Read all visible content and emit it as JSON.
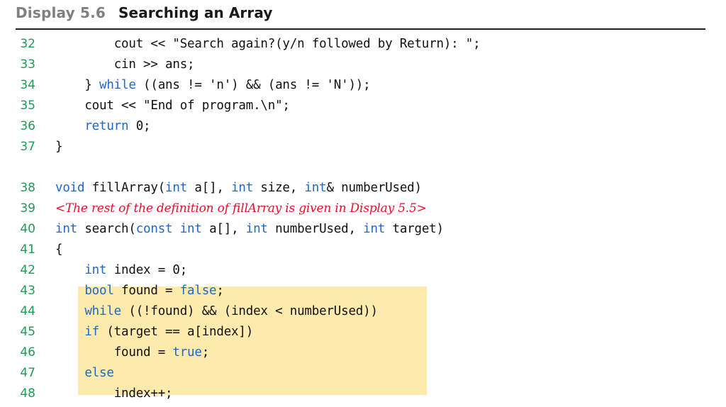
{
  "header": {
    "display_label": "Display 5.6",
    "title": "Searching an Array"
  },
  "highlight": {
    "color": "#fdeaad",
    "first_line": "44",
    "last_line": "48"
  },
  "colors": {
    "line_number": "#1f9a57",
    "keyword": "#2069c4",
    "annotation": "#e8112d",
    "code_text": "#121212",
    "label_gray": "#808080",
    "rule": "#231f20"
  },
  "code": {
    "lines": [
      {
        "no": "32",
        "indent": "        ",
        "segments": [
          {
            "text": "cout << \"Search again?(y/n followed by Return): \";",
            "style": "plain"
          }
        ]
      },
      {
        "no": "33",
        "indent": "        ",
        "segments": [
          {
            "text": "cin >> ans;",
            "style": "plain"
          }
        ]
      },
      {
        "no": "34",
        "indent": "    ",
        "segments": [
          {
            "text": "} ",
            "style": "plain"
          },
          {
            "text": "while",
            "style": "kw"
          },
          {
            "text": " ((ans != 'n') && (ans != 'N'));",
            "style": "plain"
          }
        ]
      },
      {
        "no": "35",
        "indent": "    ",
        "segments": [
          {
            "text": "cout << \"End of program.\\n\";",
            "style": "plain"
          }
        ]
      },
      {
        "no": "36",
        "indent": "    ",
        "segments": [
          {
            "text": "return",
            "style": "kw"
          },
          {
            "text": " 0;",
            "style": "plain"
          }
        ]
      },
      {
        "no": "37",
        "indent": "",
        "segments": [
          {
            "text": "}",
            "style": "plain"
          }
        ]
      },
      {
        "no": "",
        "indent": "",
        "segments": [],
        "spacer": true
      },
      {
        "no": "38",
        "indent": "",
        "segments": [
          {
            "text": "void",
            "style": "kw"
          },
          {
            "text": " fillArray(",
            "style": "plain"
          },
          {
            "text": "int",
            "style": "kw"
          },
          {
            "text": " a[], ",
            "style": "plain"
          },
          {
            "text": "int",
            "style": "kw"
          },
          {
            "text": " size, ",
            "style": "plain"
          },
          {
            "text": "int",
            "style": "kw"
          },
          {
            "text": "& numberUsed)",
            "style": "plain"
          }
        ]
      },
      {
        "no": "39",
        "indent": "",
        "segments": [
          {
            "text": "<The rest of the definition of ",
            "style": "annotation"
          },
          {
            "text": "fillArray",
            "style": "annotation-mono"
          },
          {
            "text": " is given in Display 5.5>",
            "style": "annotation"
          }
        ]
      },
      {
        "no": "40",
        "indent": "",
        "segments": [
          {
            "text": "int",
            "style": "kw"
          },
          {
            "text": " search(",
            "style": "plain"
          },
          {
            "text": "const int",
            "style": "kw"
          },
          {
            "text": " a[], ",
            "style": "plain"
          },
          {
            "text": "int",
            "style": "kw"
          },
          {
            "text": " numberUsed, ",
            "style": "plain"
          },
          {
            "text": "int",
            "style": "kw"
          },
          {
            "text": " target)",
            "style": "plain"
          }
        ]
      },
      {
        "no": "41",
        "indent": "",
        "segments": [
          {
            "text": "{",
            "style": "plain"
          }
        ]
      },
      {
        "no": "42",
        "indent": "    ",
        "segments": [
          {
            "text": "int",
            "style": "kw"
          },
          {
            "text": " index = 0;",
            "style": "plain"
          }
        ]
      },
      {
        "no": "43",
        "indent": "    ",
        "segments": [
          {
            "text": "bool",
            "style": "kw"
          },
          {
            "text": " found = ",
            "style": "plain"
          },
          {
            "text": "false",
            "style": "kw"
          },
          {
            "text": ";",
            "style": "plain"
          }
        ]
      },
      {
        "no": "44",
        "indent": "    ",
        "highlighted": true,
        "segments": [
          {
            "text": "while",
            "style": "kw"
          },
          {
            "text": " ((!found) && (index < numberUsed))",
            "style": "plain"
          }
        ]
      },
      {
        "no": "45",
        "indent": "    ",
        "highlighted": true,
        "segments": [
          {
            "text": "if",
            "style": "kw"
          },
          {
            "text": " (target == a[index])",
            "style": "plain"
          }
        ]
      },
      {
        "no": "46",
        "indent": "        ",
        "highlighted": true,
        "segments": [
          {
            "text": "found = ",
            "style": "plain"
          },
          {
            "text": "true",
            "style": "kw"
          },
          {
            "text": ";",
            "style": "plain"
          }
        ]
      },
      {
        "no": "47",
        "indent": "    ",
        "highlighted": true,
        "segments": [
          {
            "text": "else",
            "style": "kw"
          }
        ]
      },
      {
        "no": "48",
        "indent": "        ",
        "highlighted": true,
        "segments": [
          {
            "text": "index++;",
            "style": "plain"
          }
        ]
      }
    ]
  }
}
